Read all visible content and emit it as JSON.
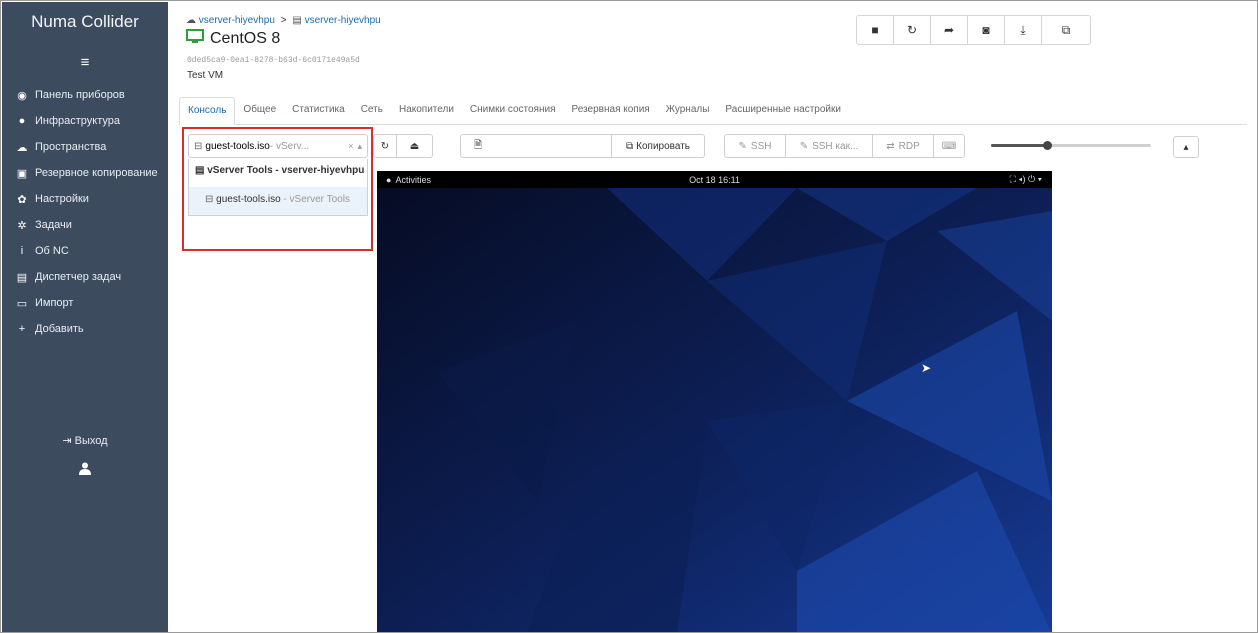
{
  "app": {
    "title": "Numa Collider"
  },
  "sidebar": {
    "menu_icon": "≡",
    "items": [
      {
        "label": "Панель приборов",
        "icon": "dashboard-icon",
        "glyph": "◉"
      },
      {
        "label": "Инфраструктура",
        "icon": "globe-icon",
        "glyph": "●"
      },
      {
        "label": "Пространства",
        "icon": "cloud-icon",
        "glyph": "☁"
      },
      {
        "label": "Резервное копирование",
        "icon": "backup-icon",
        "glyph": "▣"
      },
      {
        "label": "Настройки",
        "icon": "gear-icon",
        "glyph": "✿"
      },
      {
        "label": "Задачи",
        "icon": "tasks-icon",
        "glyph": "✲"
      },
      {
        "label": "Об NC",
        "icon": "info-icon",
        "glyph": "i"
      },
      {
        "label": "Диспетчер задач",
        "icon": "task-manager-icon",
        "glyph": "▤"
      },
      {
        "label": "Импорт",
        "icon": "import-icon",
        "glyph": "▭"
      },
      {
        "label": "Добавить",
        "icon": "plus-icon",
        "glyph": "+"
      }
    ],
    "logout_label": "Выход",
    "user_icon": "user-icon"
  },
  "header": {
    "breadcrumb_pool": "vserver-hiyevhpu",
    "breadcrumb_host": "vserver-hiyevhpu",
    "title": "CentOS 8",
    "uuid": "0ded5ca9-0ea1-8278-b63d-6c0171e49a5d",
    "description": "Test VM"
  },
  "actions": [
    {
      "name": "stop-icon",
      "glyph": "■"
    },
    {
      "name": "restart-icon",
      "glyph": "↻"
    },
    {
      "name": "migrate-icon",
      "glyph": "➦"
    },
    {
      "name": "snapshot-icon",
      "glyph": "◙"
    },
    {
      "name": "export-icon",
      "glyph": "⤓"
    },
    {
      "name": "copy-icon",
      "glyph": "⧉"
    }
  ],
  "tabs": [
    "Консоль",
    "Общее",
    "Статистика",
    "Сеть",
    "Накопители",
    "Снимки состояния",
    "Резервная копия",
    "Журналы",
    "Расширенные настройки"
  ],
  "active_tab": 0,
  "toolbar": {
    "iso_value": "guest-tools.iso",
    "iso_value_sr": " - vServ...",
    "iso_clear": "×",
    "copy_label": "Копировать",
    "ssh_label": "SSH",
    "ssh_as_label": "SSH как...",
    "rdp_label": "RDP",
    "scale_value": 0.35
  },
  "dropdown": {
    "group_label": "vServer Tools - vserver-hiyevhpu",
    "option_name": "guest-tools.iso",
    "option_sr": " - vServer Tools"
  },
  "vm_screen": {
    "activities_label": "Activities",
    "clock": "Oct 18 16:11",
    "system_icons": "⛶ ◂) ⏻ ▾"
  },
  "colors": {
    "sidebar_bg": "#3d4b5f",
    "accent": "#1a6cb0",
    "vm_icon": "#2e9e3a",
    "highlight_border": "#d32f2f",
    "console_bg": "#0b1535"
  }
}
